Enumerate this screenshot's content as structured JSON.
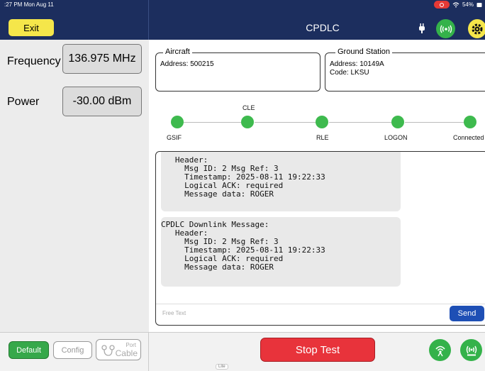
{
  "status_bar": {
    "time": ":27 PM  Mon Aug 11",
    "battery": "54%"
  },
  "header": {
    "exit_label": "Exit",
    "title": "CPDLC"
  },
  "left_panel": {
    "frequency_label": "Frequency",
    "frequency_value": "136.975 MHz",
    "power_label": "Power",
    "power_value": "-30.00 dBm"
  },
  "aircraft": {
    "legend": "Aircraft",
    "address": "Address: 500215"
  },
  "ground_station": {
    "legend": "Ground Station",
    "address": "Address: 10149A",
    "code": "Code: LKSU"
  },
  "steps": [
    {
      "label": "GSIF",
      "status": "complete"
    },
    {
      "label": "CLE",
      "status": "complete"
    },
    {
      "label": "RLE",
      "status": "complete"
    },
    {
      "label": "LOGON",
      "status": "complete"
    },
    {
      "label": "Connected",
      "status": "complete"
    }
  ],
  "messages": [
    {
      "text": "   Header:\n     Msg ID: 2 Msg Ref: 3\n     Timestamp: 2025-08-11 19:22:33\n     Logical ACK: required\n     Message data: ROGER"
    },
    {
      "text": "CPDLC Downlink Message:\n   Header:\n     Msg ID: 2 Msg Ref: 3\n     Timestamp: 2025-08-11 19:22:33\n     Logical ACK: required\n     Message data: ROGER"
    }
  ],
  "compose": {
    "placeholder": "Free Text",
    "send_label": "Send"
  },
  "bottom": {
    "default_label": "Default",
    "config_label": "Config",
    "port_label": "Port",
    "cable_label": "Cable",
    "stop_label": "Stop Test",
    "lite_tag": "Lite"
  },
  "colors": {
    "header_bg": "#1c2e5e",
    "accent_green": "#34b24a",
    "exit_yellow": "#f5e64a",
    "stop_red": "#e8333b",
    "send_blue": "#1e4fb5"
  }
}
